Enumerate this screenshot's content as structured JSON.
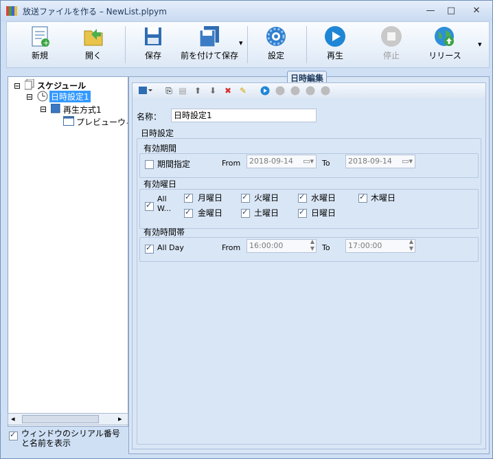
{
  "window": {
    "title": "放送ファイルを作る  –  NewList.plpym",
    "min": "—",
    "max": "□",
    "close": "✕"
  },
  "toolbar": {
    "new": "新規",
    "open": "開く",
    "save": "保存",
    "save_as": "前を付けて保存",
    "settings": "設定",
    "play": "再生",
    "stop": "停止",
    "release": "リリース"
  },
  "tree": {
    "root": "スケジュール",
    "date_setting": "日時設定1",
    "playback": "再生方式1",
    "preview": "プレビューウィ"
  },
  "footer": {
    "serial_label": "ウィンドウのシリアル番号と名前を表示"
  },
  "editor": {
    "panel_title": "日時編集",
    "name_label": "名称：",
    "name_value": "日時設定1",
    "date_group": "日時設定",
    "period_group": "有効期間",
    "period_check": "期間指定",
    "from": "From",
    "to": "To",
    "period_from": "2018-09-14",
    "period_to": "2018-09-14",
    "weekday_group": "有効曜日",
    "all_week": "All W...",
    "days": [
      "月曜日",
      "火曜日",
      "水曜日",
      "木曜日",
      "金曜日",
      "土曜日",
      "日曜日"
    ],
    "time_group": "有効時間帯",
    "all_day": "All Day",
    "time_from": "16:00:00",
    "time_to": "17:00:00"
  }
}
